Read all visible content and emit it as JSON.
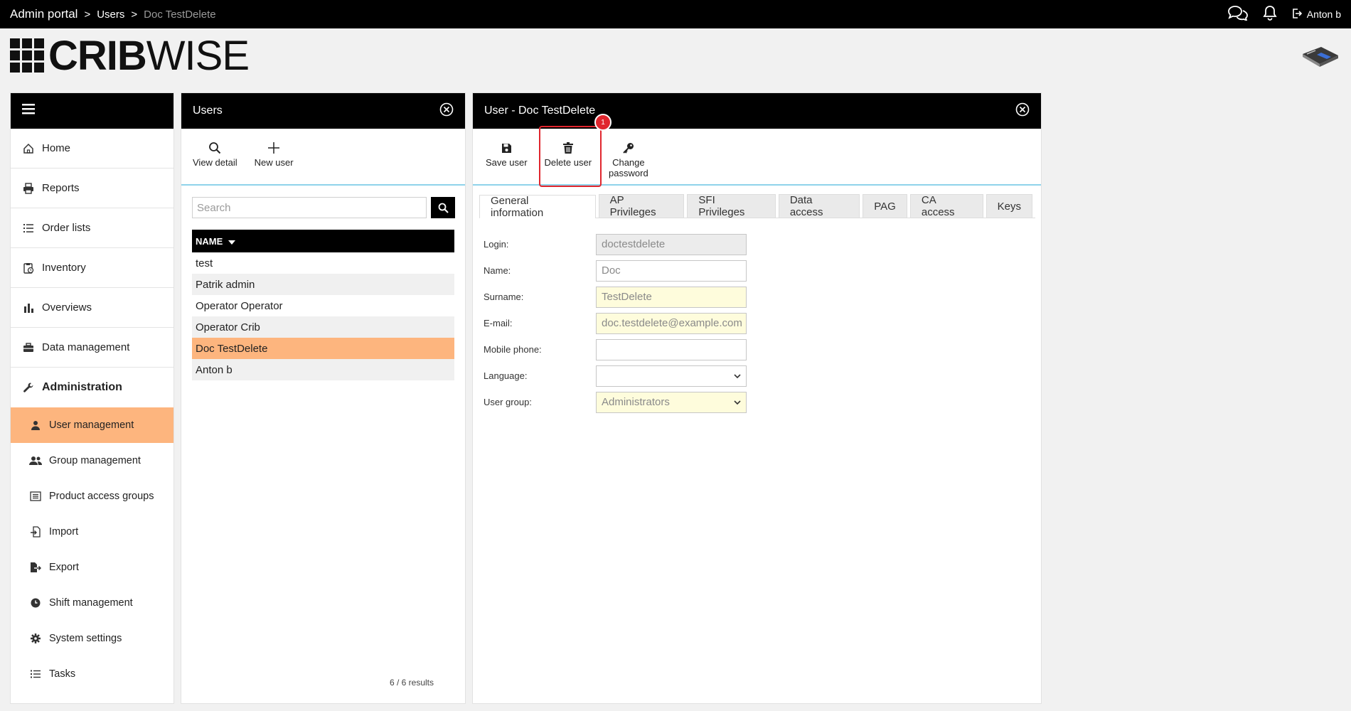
{
  "topbar": {
    "crumbs": [
      "Admin portal",
      "Users",
      "Doc TestDelete"
    ],
    "separator": ">",
    "user_name": "Anton b",
    "icons": [
      "chat-icon",
      "bell-icon",
      "logout-icon"
    ]
  },
  "logo": {
    "bold": "CRIB",
    "light": "WISE"
  },
  "nav": {
    "items": [
      {
        "label": "Home",
        "icon": "home-icon"
      },
      {
        "label": "Reports",
        "icon": "printer-icon"
      },
      {
        "label": "Order lists",
        "icon": "list-icon"
      },
      {
        "label": "Inventory",
        "icon": "clipboard-icon"
      },
      {
        "label": "Overviews",
        "icon": "bar-chart-icon"
      },
      {
        "label": "Data management",
        "icon": "briefcase-icon"
      },
      {
        "label": "Administration",
        "icon": "wrench-icon"
      }
    ],
    "sub_items": [
      {
        "label": "User management",
        "icon": "user-icon"
      },
      {
        "label": "Group management",
        "icon": "users-icon"
      },
      {
        "label": "Product access groups",
        "icon": "list-box-icon"
      },
      {
        "label": "Import",
        "icon": "import-icon"
      },
      {
        "label": "Export",
        "icon": "export-icon"
      },
      {
        "label": "Shift management",
        "icon": "clock-icon"
      },
      {
        "label": "System settings",
        "icon": "gear-icon"
      },
      {
        "label": "Tasks",
        "icon": "tasks-icon"
      }
    ]
  },
  "users_panel": {
    "title": "Users",
    "toolbar": {
      "view_detail": "View detail",
      "new_user": "New user"
    },
    "search_placeholder": "Search",
    "column": "NAME",
    "rows": [
      "test",
      "Patrik admin",
      "Operator Operator",
      "Operator Crib",
      "Doc TestDelete",
      "Anton b"
    ],
    "selected": "Doc TestDelete",
    "results": "6 / 6 results"
  },
  "detail_panel": {
    "title": "User - Doc TestDelete",
    "toolbar": {
      "save": "Save user",
      "delete": "Delete user",
      "change_1": "Change",
      "change_2": "password"
    },
    "badge": "1",
    "tabs": [
      "General information",
      "AP Privileges",
      "SFI Privileges",
      "Data access",
      "PAG",
      "CA access",
      "Keys"
    ],
    "form": {
      "login_label": "Login:",
      "login_value": "doctestdelete",
      "name_label": "Name:",
      "name_value": "Doc",
      "surname_label": "Surname:",
      "surname_value": "TestDelete",
      "email_label": "E-mail:",
      "email_value": "doc.testdelete@example.com",
      "mobile_label": "Mobile phone:",
      "mobile_value": "",
      "language_label": "Language:",
      "language_value": "",
      "group_label": "User group:",
      "group_value": "Administrators"
    }
  },
  "colors": {
    "accent": "#fdb57e",
    "topbar": "#000000",
    "highlight": "#e0262e",
    "divider": "#8fd3ea"
  }
}
